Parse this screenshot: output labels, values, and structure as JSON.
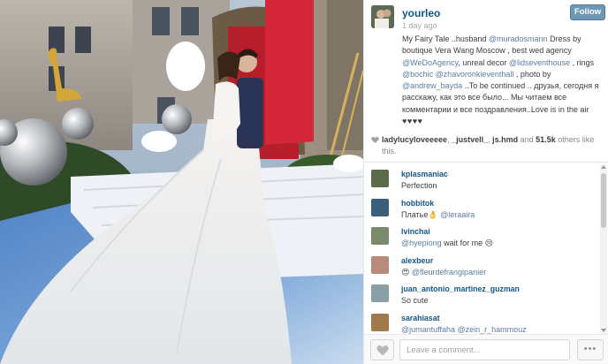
{
  "post": {
    "username": "yourleo",
    "time_ago": "1 day ago",
    "follow_label": "Follow",
    "caption_parts": [
      {
        "t": "My Fairy Tale ..husband ",
        "m": false
      },
      {
        "t": "@muradosmann",
        "m": true
      },
      {
        "t": " Dress by boutique Vera Wang Moscow , best wed agency ",
        "m": false
      },
      {
        "t": "@WeDoAgency",
        "m": true
      },
      {
        "t": ", unreal decor ",
        "m": false
      },
      {
        "t": "@lidseventhouse",
        "m": true
      },
      {
        "t": " , rings ",
        "m": false
      },
      {
        "t": "@bochic",
        "m": true
      },
      {
        "t": " ",
        "m": false
      },
      {
        "t": "@zhavoronkieventhall",
        "m": true
      },
      {
        "t": " , photo by ",
        "m": false
      },
      {
        "t": "@andrew_bayda",
        "m": true
      },
      {
        "t": " ..To be continued .. друзья, сегодня я расскажу, как это все было... Мы читаем все комментарии и все поздравления..Love is in the air ",
        "m": false
      }
    ],
    "hearts": "♥♥♥♥"
  },
  "likes": {
    "liker1": "ladylucyloveeeee",
    "sep1": ", ",
    "liker2": "_justvell_",
    "sep2": ", ",
    "liker3": "js.hmd",
    "and": " and ",
    "count": "51.5k",
    "suffix": " others like this."
  },
  "comments": [
    {
      "user": "kplasmaniac",
      "text": "Perfection",
      "mention": "",
      "avatar_color": "#5a6b4a"
    },
    {
      "user": "hobbitok",
      "text": "Платье👌 ",
      "mention": "@leraaira",
      "avatar_color": "#3b5f7a"
    },
    {
      "user": "lvinchai",
      "text": "",
      "mention": "@hyepiong",
      "after": " wait for me 😢",
      "avatar_color": "#7a8a6a"
    },
    {
      "user": "alexbeur",
      "text": "😍 ",
      "mention": "@fleurdefrangipanier",
      "avatar_color": "#b88a7a"
    },
    {
      "user": "juan_antonio_martinez_guzman",
      "text": "So cute",
      "mention": "",
      "avatar_color": "#8aa0a8"
    },
    {
      "user": "sarahiasat",
      "text": "",
      "mention": "@jumantuffaha @zein_r_hammouz",
      "avatar_color": "#a07a4a"
    }
  ],
  "footer": {
    "comment_placeholder": "Leave a comment...",
    "more_label": "•••"
  },
  "icons": {
    "like": "heart-icon",
    "likes_count": "heart-small-icon"
  },
  "colors": {
    "username": "#125688",
    "mention": "#5c7da3",
    "follow_bg": "#6f97b6"
  }
}
